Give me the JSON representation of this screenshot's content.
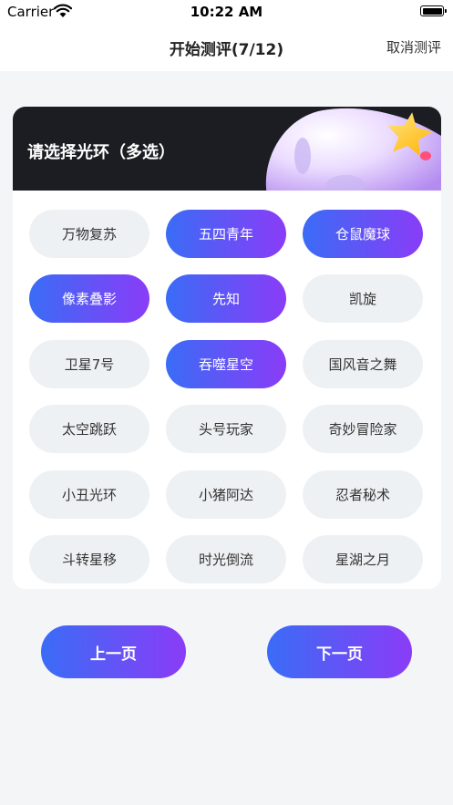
{
  "status_bar": {
    "carrier": "Carrier",
    "time": "10:22 AM"
  },
  "nav": {
    "title": "开始测评(7/12)",
    "cancel_label": "取消测评"
  },
  "card": {
    "title": "请选择光环（多选）"
  },
  "options": [
    {
      "label": "万物复苏",
      "selected": false
    },
    {
      "label": "五四青年",
      "selected": true
    },
    {
      "label": "仓鼠魔球",
      "selected": true
    },
    {
      "label": "像素叠影",
      "selected": true
    },
    {
      "label": "先知",
      "selected": true
    },
    {
      "label": "凯旋",
      "selected": false
    },
    {
      "label": "卫星7号",
      "selected": false
    },
    {
      "label": "吞噬星空",
      "selected": true
    },
    {
      "label": "国风音之舞",
      "selected": false
    },
    {
      "label": "太空跳跃",
      "selected": false
    },
    {
      "label": "头号玩家",
      "selected": false
    },
    {
      "label": "奇妙冒险家",
      "selected": false
    },
    {
      "label": "小丑光环",
      "selected": false
    },
    {
      "label": "小猪阿达",
      "selected": false
    },
    {
      "label": "忍者秘术",
      "selected": false
    },
    {
      "label": "斗转星移",
      "selected": false
    },
    {
      "label": "时光倒流",
      "selected": false
    },
    {
      "label": "星湖之月",
      "selected": false
    }
  ],
  "footer": {
    "prev_label": "上一页",
    "next_label": "下一页"
  },
  "colors": {
    "gradient_start": "#3a6cf6",
    "gradient_end": "#8a3cf7",
    "chip_bg": "#eef1f3",
    "header_bg": "#1c1d22"
  }
}
